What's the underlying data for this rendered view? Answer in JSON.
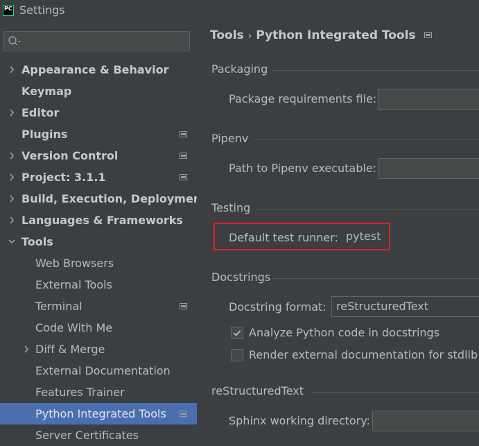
{
  "window": {
    "title": "Settings",
    "app_icon": "pc-icon"
  },
  "sidebar": {
    "search": {
      "placeholder": "",
      "value": ""
    },
    "items": [
      {
        "label": "Appearance & Behavior",
        "expandable": true,
        "expanded": false
      },
      {
        "label": "Keymap",
        "expandable": false
      },
      {
        "label": "Editor",
        "expandable": true,
        "expanded": false
      },
      {
        "label": "Plugins",
        "expandable": false,
        "project_icon": true
      },
      {
        "label": "Version Control",
        "expandable": true,
        "expanded": false,
        "project_icon": true
      },
      {
        "label": "Project: 3.1.1",
        "expandable": true,
        "expanded": false,
        "project_icon": true
      },
      {
        "label": "Build, Execution, Deployment",
        "expandable": true,
        "expanded": false
      },
      {
        "label": "Languages & Frameworks",
        "expandable": true,
        "expanded": false
      },
      {
        "label": "Tools",
        "expandable": true,
        "expanded": true
      },
      {
        "label": "Web Browsers"
      },
      {
        "label": "External Tools"
      },
      {
        "label": "Terminal",
        "project_icon": true
      },
      {
        "label": "Code With Me"
      },
      {
        "label": "Diff & Merge",
        "expandable": true,
        "expanded": false
      },
      {
        "label": "External Documentation"
      },
      {
        "label": "Features Trainer"
      },
      {
        "label": "Python Integrated Tools",
        "selected": true,
        "project_icon": true
      },
      {
        "label": "Server Certificates"
      }
    ]
  },
  "main": {
    "breadcrumb": {
      "parent": "Tools",
      "separator": "›",
      "current": "Python Integrated Tools"
    },
    "packaging": {
      "title": "Packaging",
      "requirements_label": "Package requirements file:",
      "requirements_value": ""
    },
    "pipenv": {
      "title": "Pipenv",
      "path_label": "Path to Pipenv executable:",
      "path_value": ""
    },
    "testing": {
      "title": "Testing",
      "runner_label": "Default test runner:",
      "runner_value": "pytest"
    },
    "docstrings": {
      "title": "Docstrings",
      "format_label": "Docstring format:",
      "format_value": "reStructuredText",
      "analyze_label": "Analyze Python code in docstrings",
      "analyze_checked": true,
      "render_label": "Render external documentation for stdlib",
      "render_checked": false
    },
    "rest": {
      "title": "reStructuredText",
      "sphinx_label": "Sphinx working directory:",
      "sphinx_value": ""
    }
  },
  "colors": {
    "background": "#3c3f41",
    "selection": "#4b6eaf",
    "highlight_box": "#e0212b",
    "text": "#bbbbbb"
  }
}
